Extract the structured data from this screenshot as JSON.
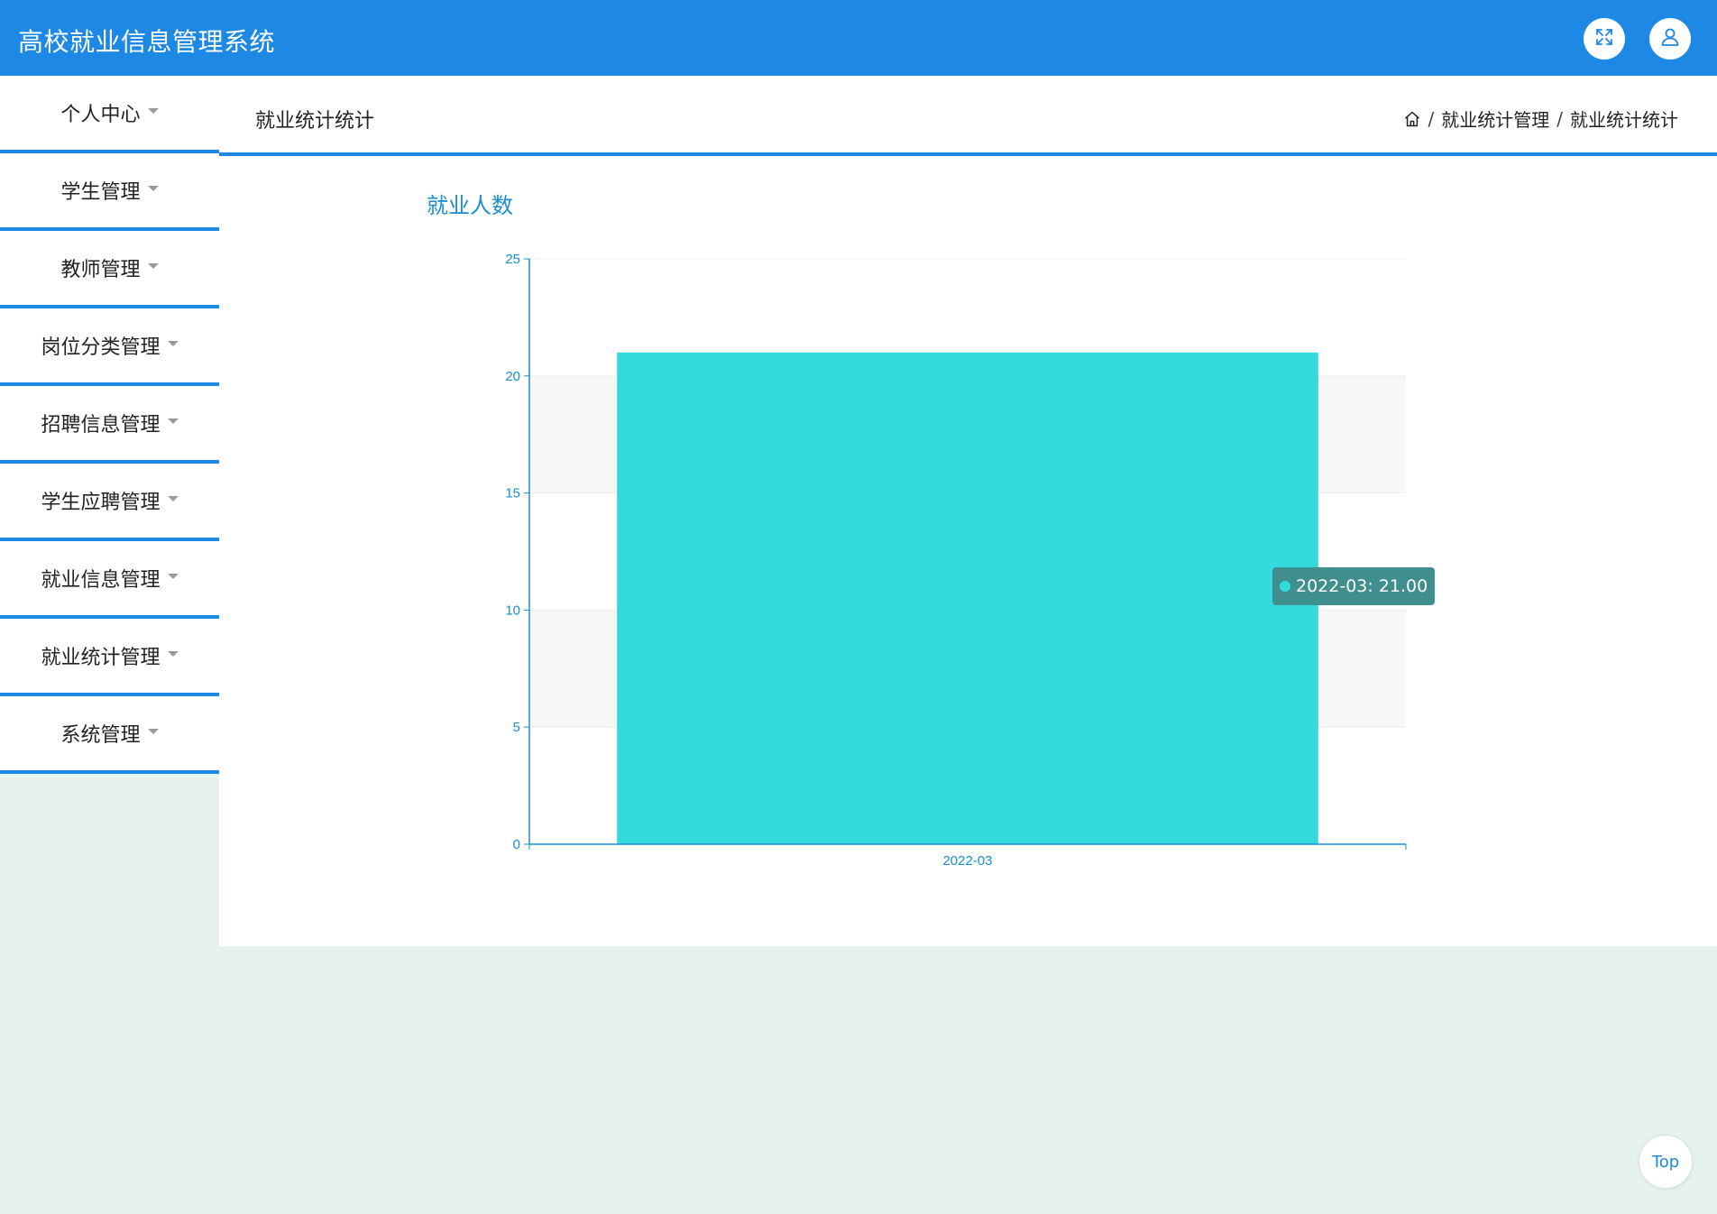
{
  "header": {
    "app_title": "高校就业信息管理系统",
    "fullscreen_icon": "fullscreen-icon",
    "user_icon": "user-icon"
  },
  "sidebar": {
    "items": [
      {
        "label": "个人中心"
      },
      {
        "label": "学生管理"
      },
      {
        "label": "教师管理"
      },
      {
        "label": "岗位分类管理"
      },
      {
        "label": "招聘信息管理"
      },
      {
        "label": "学生应聘管理"
      },
      {
        "label": "就业信息管理"
      },
      {
        "label": "就业统计管理"
      },
      {
        "label": "系统管理"
      }
    ]
  },
  "page": {
    "title": "就业统计统计",
    "breadcrumb": [
      "就业统计管理",
      "就业统计统计"
    ],
    "breadcrumb_separator": "/"
  },
  "chart_data": {
    "type": "bar",
    "title": "就业人数",
    "categories": [
      "2022-03"
    ],
    "values": [
      21
    ],
    "ylim": [
      0,
      25
    ],
    "yticks": [
      0,
      5,
      10,
      15,
      20,
      25
    ],
    "grid": true,
    "xlabel": "",
    "ylabel": "",
    "bar_color": "#34d9dc",
    "axis_color": "#1a8fcf"
  },
  "tooltip": {
    "text": "2022-03: 21.00"
  },
  "back_to_top": {
    "label": "Top"
  },
  "colors": {
    "primary": "#1e88e5",
    "page_background": "#e6f2ec"
  }
}
